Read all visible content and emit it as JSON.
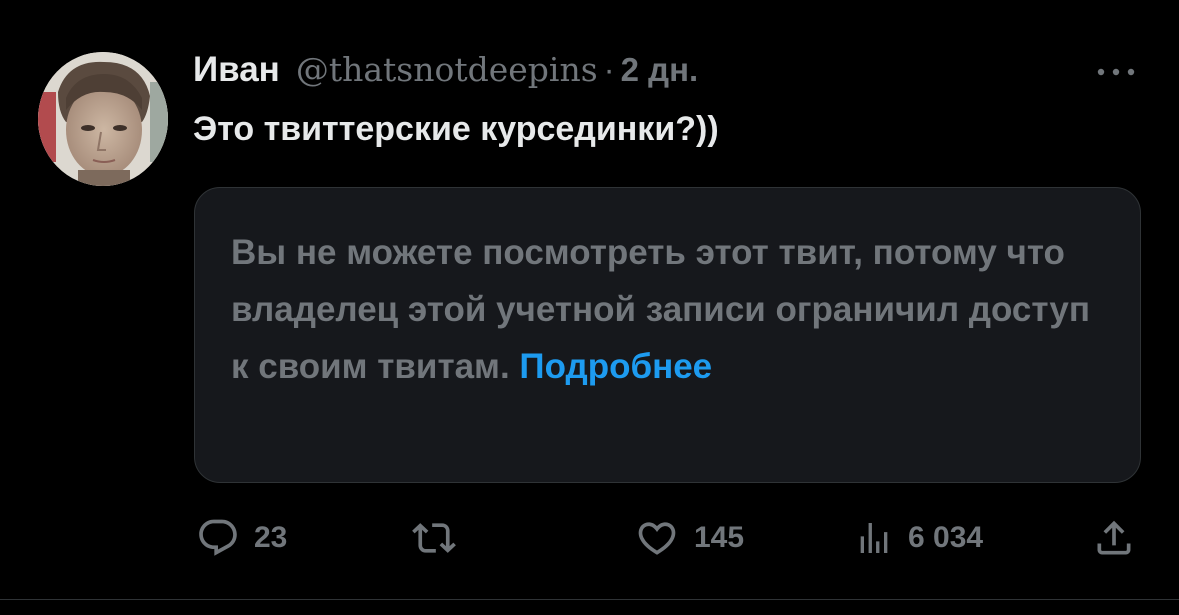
{
  "tweet": {
    "author_name": "Иван",
    "handle": "@thatsnotdeepins",
    "separator": "·",
    "time": "2 дн.",
    "text": "Это твиттерские курсединки?))",
    "more_icon": "more-dots-icon"
  },
  "notice": {
    "message": "Вы не можете посмотреть этот твит, потому что владелец этой учетной записи ограничил доступ к своим твитам.",
    "link_label": "Подробнее"
  },
  "actions": {
    "reply_count": "23",
    "retweet_count": "",
    "like_count": "145",
    "views_count": "6 034"
  },
  "colors": {
    "background": "#000000",
    "primary_text": "#e7e9ea",
    "secondary_text": "#71767b",
    "link": "#1d9bf0",
    "card_background": "#16181c",
    "border": "#2f3336"
  }
}
